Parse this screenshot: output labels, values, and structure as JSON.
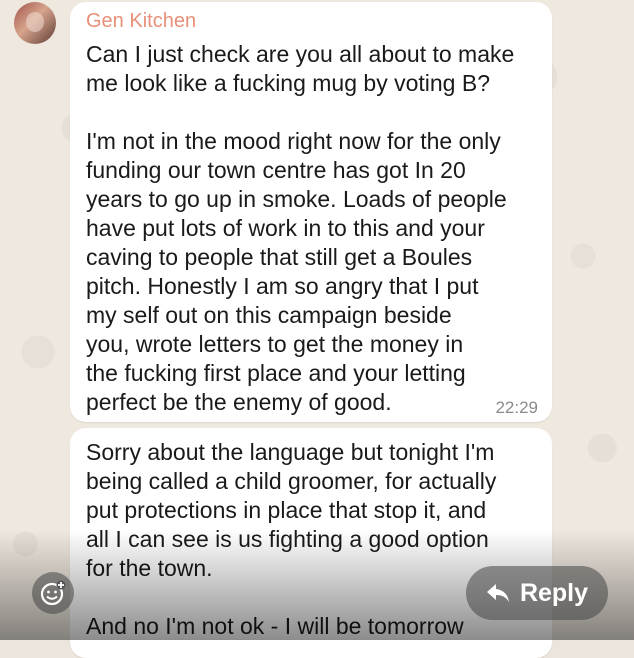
{
  "chat": {
    "messages": [
      {
        "sender": "Gen Kitchen",
        "text": "Can I just check are you all about to make\nme look like a fucking mug by voting B?\n\nI'm not in the mood right now for the only\nfunding our town centre has got In 20\nyears to go up in smoke. Loads of people\nhave put lots of work in to this and your\ncaving to people that still get a Boules\npitch. Honestly I am so angry that I put\nmy self out on this campaign beside\nyou, wrote letters to get the money in\nthe fucking first place and your letting\nperfect be the enemy of good.",
        "time": "22:29"
      },
      {
        "text": "Sorry about the language but tonight I'm\nbeing called a child groomer, for actually\nput protections in place that stop it, and\nall I can see is us fighting a good option\nfor the town.\n\nAnd no I'm not ok - I will be tomorrow"
      }
    ]
  },
  "actions": {
    "reply_label": "Reply",
    "react_icon": "emoji-add-icon",
    "reply_icon": "reply-arrow-icon"
  },
  "colors": {
    "sender_name": "#e8907a",
    "bubble": "#ffffff",
    "wallpaper": "#efe8df"
  }
}
